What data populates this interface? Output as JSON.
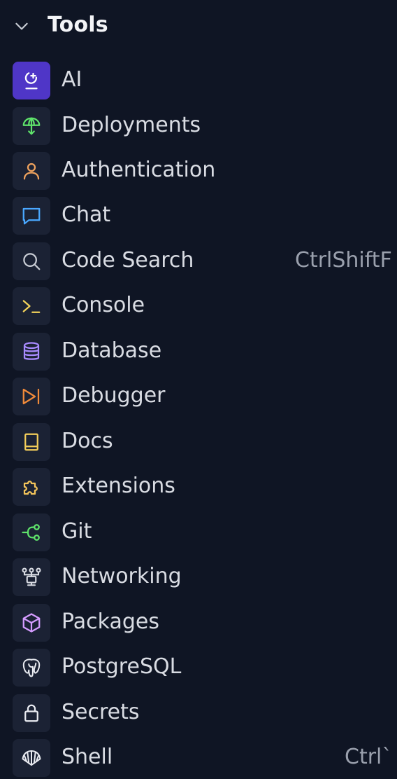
{
  "panel": {
    "title": "Tools"
  },
  "tools": [
    {
      "label": "AI",
      "icon": "ai-icon",
      "color": "#ffffff"
    },
    {
      "label": "Deployments",
      "icon": "deployments-icon",
      "color": "#5fe36b"
    },
    {
      "label": "Authentication",
      "icon": "user-icon",
      "color": "#f0a35e"
    },
    {
      "label": "Chat",
      "icon": "chat-icon",
      "color": "#4aa8ff"
    },
    {
      "label": "Code Search",
      "icon": "search-icon",
      "color": "#c7cbd3",
      "shortcut": "CtrlShiftF"
    },
    {
      "label": "Console",
      "icon": "console-icon",
      "color": "#f3d35a"
    },
    {
      "label": "Database",
      "icon": "database-icon",
      "color": "#a98bff"
    },
    {
      "label": "Debugger",
      "icon": "debugger-icon",
      "color": "#f08a3a"
    },
    {
      "label": "Docs",
      "icon": "book-icon",
      "color": "#f3cd5a"
    },
    {
      "label": "Extensions",
      "icon": "puzzle-icon",
      "color": "#f3c45a"
    },
    {
      "label": "Git",
      "icon": "git-icon",
      "color": "#5fe36b"
    },
    {
      "label": "Networking",
      "icon": "network-icon",
      "color": "#d8dbe2"
    },
    {
      "label": "Packages",
      "icon": "package-icon",
      "color": "#d59cff"
    },
    {
      "label": "PostgreSQL",
      "icon": "postgresql-icon",
      "color": "#e8eaf0"
    },
    {
      "label": "Secrets",
      "icon": "lock-icon",
      "color": "#e8eaf0"
    },
    {
      "label": "Shell",
      "icon": "shell-icon",
      "color": "#e8eaf0",
      "shortcut": "Ctrl`"
    }
  ]
}
